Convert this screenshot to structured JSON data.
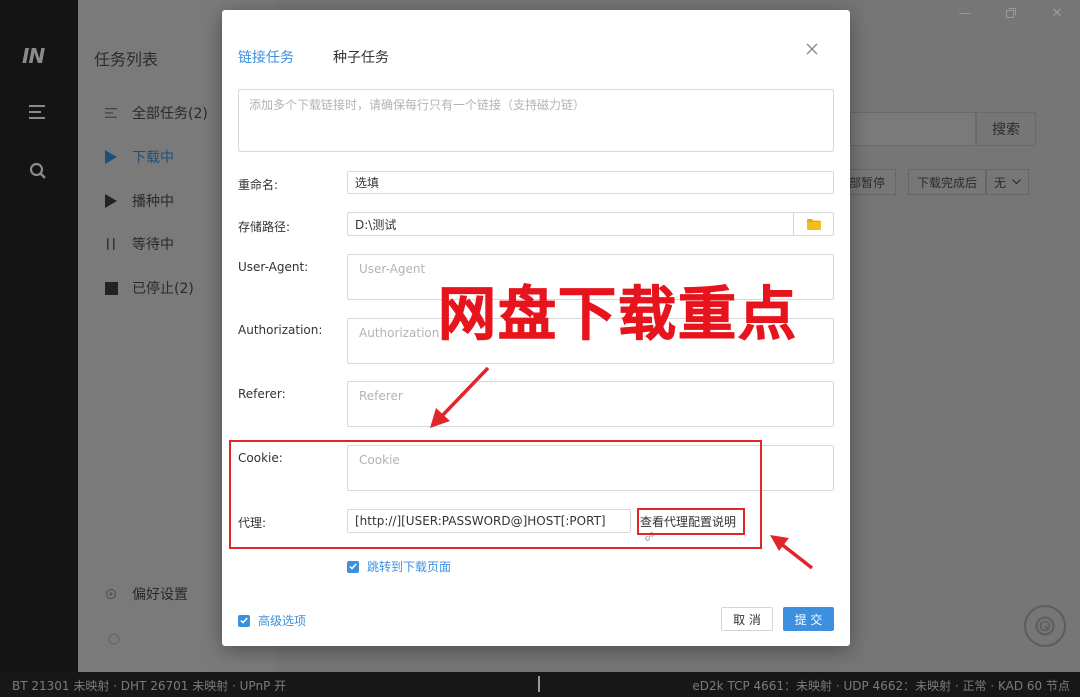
{
  "app": {
    "logo": "IN",
    "sidebar": {
      "title": "任务列表",
      "items": [
        {
          "label": "全部任务(2)"
        },
        {
          "label": "下载中"
        },
        {
          "label": "播种中"
        },
        {
          "label": "等待中"
        },
        {
          "label": "已停止(2)"
        }
      ],
      "settings_label": "偏好设置"
    },
    "toolbar": {
      "search_button": "搜索",
      "pause_all_partial": "部暂停",
      "after_complete_label": "下载完成后",
      "after_complete_value": "无"
    },
    "statusbar": {
      "left": "BT 21301 未映射 · DHT 26701 未映射 · UPnP 开",
      "right": "eD2k TCP 4661：未映射 · UDP 4662：未映射 · 正常 · KAD 60 节点"
    }
  },
  "dialog": {
    "tabs": [
      {
        "label": "链接任务",
        "active": true
      },
      {
        "label": "种子任务",
        "active": false
      }
    ],
    "links_placeholder": "添加多个下载链接时，请确保每行只有一个链接（支持磁力链）",
    "rename": {
      "label": "重命名:",
      "value": "选填"
    },
    "save_path": {
      "label": "存储路径:",
      "value": "D:\\测试"
    },
    "user_agent": {
      "label": "User-Agent:",
      "placeholder": "User-Agent"
    },
    "authorization": {
      "label": "Authorization:",
      "placeholder": "Authorization"
    },
    "referer": {
      "label": "Referer:",
      "placeholder": "Referer"
    },
    "cookie": {
      "label": "Cookie:",
      "placeholder": "Cookie"
    },
    "proxy": {
      "label": "代理:",
      "value": "[http://][USER:PASSWORD@]HOST[:PORT]",
      "help_link": "查看代理配置说明"
    },
    "jump_to_download": {
      "label": "跳转到下载页面",
      "checked": true
    },
    "advanced": {
      "label": "高级选项",
      "checked": true
    },
    "cancel_label": "取 消",
    "submit_label": "提 交",
    "accent_color": "#3d8fe0"
  },
  "annotation": {
    "headline": "网盘下载重点",
    "color": "#e8141d"
  }
}
